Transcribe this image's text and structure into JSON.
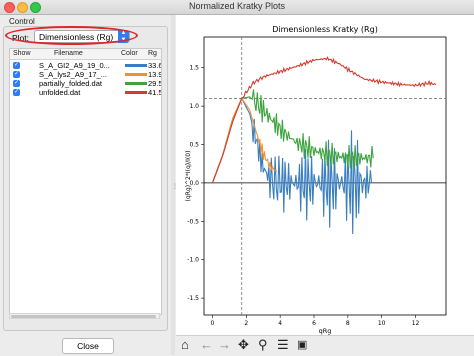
{
  "window": {
    "title": "Normalized Kratky Plots"
  },
  "control": {
    "group_label": "Control",
    "plot_label": "Plot:",
    "plot_value": "Dimensionless (Rg)",
    "columns": [
      "Show",
      "Filename",
      "Color",
      "Rg"
    ],
    "rows": [
      {
        "checked": true,
        "filename": "S_A_GI2_A9_19_0...",
        "color": "#3a7ebf",
        "rg": "33.6"
      },
      {
        "checked": true,
        "filename": "S_A_lys2_A9_17_...",
        "color": "#f2912c",
        "rg": "13.9"
      },
      {
        "checked": true,
        "filename": "partially_folded.dat",
        "color": "#3da33d",
        "rg": "29.5"
      },
      {
        "checked": true,
        "filename": "unfolded.dat",
        "color": "#d33b2c",
        "rg": "41.5"
      }
    ],
    "close_label": "Close"
  },
  "chart_data": {
    "type": "line",
    "title": "Dimensionless Kratky (Rg)",
    "xlabel": "qRg",
    "ylabel": "(qRg)^2*I(q)/I(0)",
    "xlim": [
      -0.5,
      13.8
    ],
    "ylim": [
      -1.72,
      1.9
    ],
    "xticks": [
      "0",
      "2",
      "4",
      "6",
      "8",
      "10",
      "12"
    ],
    "yticks": [
      "-1.5",
      "-1.0",
      "-0.5",
      "0.0",
      "0.5",
      "1.0",
      "1.5"
    ],
    "reference_lines": {
      "vertical_x": 1.73,
      "horizontal_y": 1.1,
      "zero_y": 0
    },
    "series": [
      {
        "color": "#d33b2c",
        "x": [
          0,
          0.6,
          1.2,
          1.73,
          2.4,
          3,
          4,
          5,
          6,
          6.8,
          7.5,
          8.2,
          9,
          9.8,
          10.5,
          11.2,
          12,
          12.8,
          13.2
        ],
        "y": [
          0,
          0.35,
          0.8,
          1.1,
          1.3,
          1.38,
          1.45,
          1.52,
          1.6,
          1.62,
          1.55,
          1.45,
          1.35,
          1.32,
          1.3,
          1.28,
          1.27,
          1.3,
          1.28
        ]
      },
      {
        "color": "#3da33d",
        "x": [
          0,
          0.6,
          1.2,
          1.73,
          2.2,
          2.8,
          3.5,
          4.2,
          5,
          6,
          7,
          8,
          9.5
        ],
        "y": [
          0,
          0.36,
          0.84,
          1.1,
          1.12,
          1.0,
          0.82,
          0.66,
          0.52,
          0.42,
          0.36,
          0.33,
          0.32
        ]
      },
      {
        "color": "#3a7ebf",
        "x": [
          0,
          0.6,
          1.2,
          1.73,
          2.2,
          2.6,
          3.0,
          3.4,
          4.0,
          5,
          6,
          7,
          8,
          9,
          9.4
        ],
        "y": [
          0,
          0.36,
          0.84,
          1.1,
          0.9,
          0.55,
          0.2,
          0.05,
          0.0,
          0.0,
          0.0,
          0.0,
          0.0,
          0.0,
          0.0
        ]
      },
      {
        "color": "#f2912c",
        "x": [
          0,
          0.6,
          1.2,
          1.73,
          2.2,
          2.6,
          3.0,
          3.4,
          3.8
        ],
        "y": [
          0,
          0.36,
          0.84,
          1.1,
          0.95,
          0.65,
          0.38,
          0.22,
          0.15
        ]
      }
    ]
  },
  "toolbar": {
    "icons": [
      "home-icon",
      "back-icon",
      "forward-icon",
      "pan-icon",
      "zoom-icon",
      "configure-icon",
      "save-icon"
    ]
  }
}
